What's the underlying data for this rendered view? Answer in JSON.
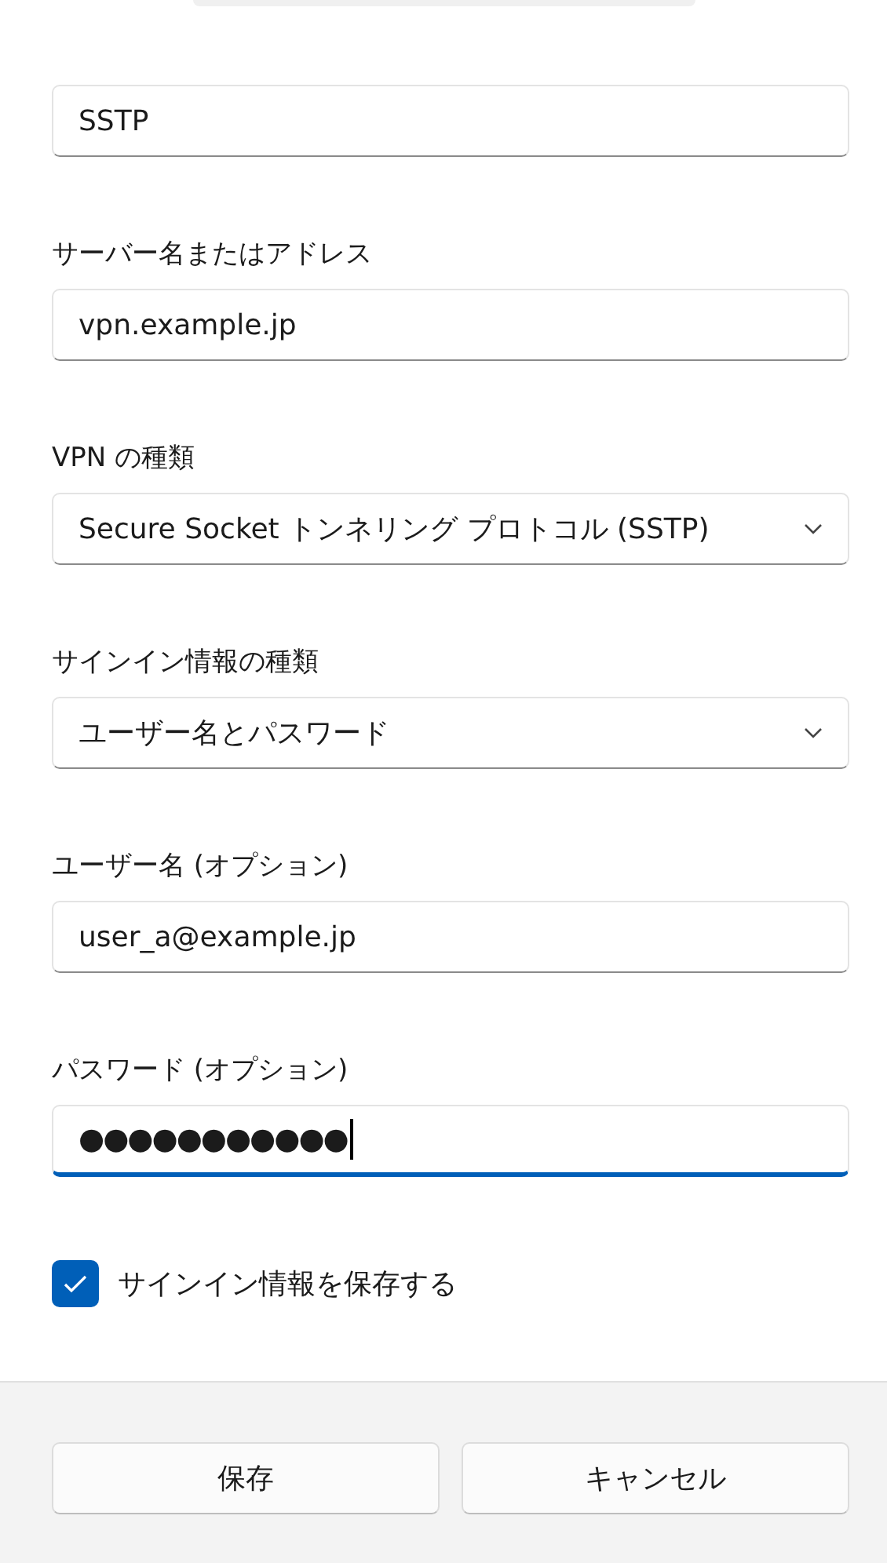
{
  "fields": [
    {
      "kind": "text",
      "value": "SSTP",
      "focused": false
    },
    {
      "kind": "text",
      "label": "サーバー名またはアドレス",
      "value": "vpn.example.jp",
      "focused": false
    },
    {
      "kind": "dropdown",
      "label": "VPN の種類",
      "value": "Secure Socket トンネリング プロトコル (SSTP)",
      "focused": false
    },
    {
      "kind": "dropdown",
      "label": "サインイン情報の種類",
      "value": "ユーザー名とパスワード",
      "focused": false
    },
    {
      "kind": "text",
      "label": "ユーザー名 (オプション)",
      "value": "user_a@example.jp",
      "focused": false
    },
    {
      "kind": "password",
      "label": "パスワード (オプション)",
      "value": "●●●●●●●●●●●",
      "focused": true
    }
  ],
  "remember": {
    "label": "サインイン情報を保存する",
    "checked": true
  },
  "buttons": [
    "保存",
    "キャンセル"
  ]
}
